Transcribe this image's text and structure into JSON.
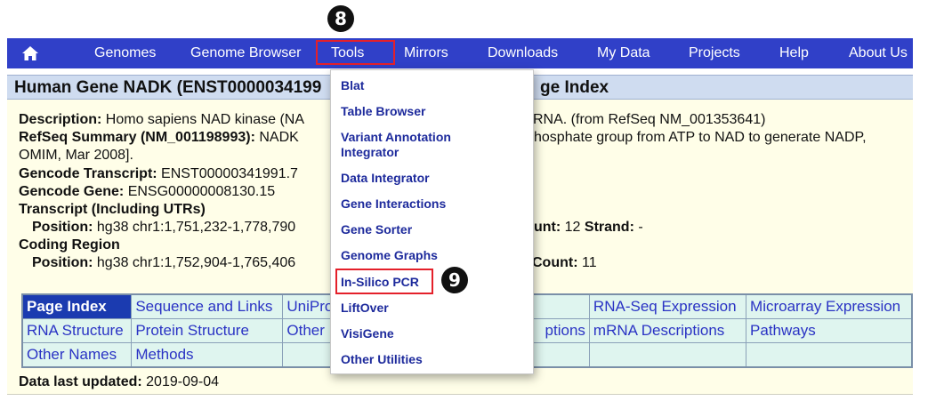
{
  "nav": {
    "items": [
      "Genomes",
      "Genome Browser",
      "Tools",
      "Mirrors",
      "Downloads",
      "My Data",
      "Projects",
      "Help",
      "About Us"
    ]
  },
  "steps": {
    "tools": "8",
    "pcr": "9"
  },
  "title": {
    "left": "Human Gene NADK (ENST0000034199",
    "right": "ge Index"
  },
  "info": {
    "desc_label": "Description:",
    "desc_value": "Homo sapiens NAD kinase (NA",
    "desc_tail": "RNA. (from RefSeq NM_001353641)",
    "refseq_label": "RefSeq Summary (NM_001198993):",
    "refseq_value": "NADK",
    "refseq_tail": "hosphate group from ATP to NAD to generate NADP,",
    "omim": "OMIM, Mar 2008].",
    "gencode_tx_label": "Gencode Transcript:",
    "gencode_tx_value": "ENST00000341991.7",
    "gencode_gene_label": "Gencode Gene:",
    "gencode_gene_value": "ENSG00000008130.15",
    "transcript_label": "Transcript (Including UTRs)",
    "pos_label": "Position:",
    "tx_pos": "hg38 chr1:1,751,232-1,778,790",
    "tx_count_label": "unt:",
    "tx_count": "12",
    "strand_label": "Strand:",
    "strand": "-",
    "coding_label": "Coding Region",
    "cds_pos": "hg38 chr1:1,752,904-1,765,406",
    "cds_count_label": "Count:",
    "cds_count": "11",
    "updated_label": "Data last updated:",
    "updated_value": "2019-09-04"
  },
  "page_index": {
    "rows": [
      [
        "Page Index",
        "Sequence and Links",
        "UniPro",
        "",
        "RNA-Seq Expression",
        "Microarray Expression"
      ],
      [
        "RNA Structure",
        "Protein Structure",
        "Other",
        "ptions",
        "mRNA Descriptions",
        "Pathways"
      ],
      [
        "Other Names",
        "Methods",
        "",
        "",
        "",
        ""
      ]
    ]
  },
  "tools_menu": {
    "items": [
      "Blat",
      "Table Browser",
      "Variant Annotation Integrator",
      "Data Integrator",
      "Gene Interactions",
      "Gene Sorter",
      "Genome Graphs",
      "In-Silico PCR",
      "LiftOver",
      "VisiGene",
      "Other Utilities"
    ]
  },
  "colors": {
    "nav_bg": "#3040c8",
    "highlight": "#e4202a",
    "menu_text": "#1d2a9c",
    "panel_bg": "#fffee8"
  },
  "icons": {
    "home": "home-icon"
  }
}
